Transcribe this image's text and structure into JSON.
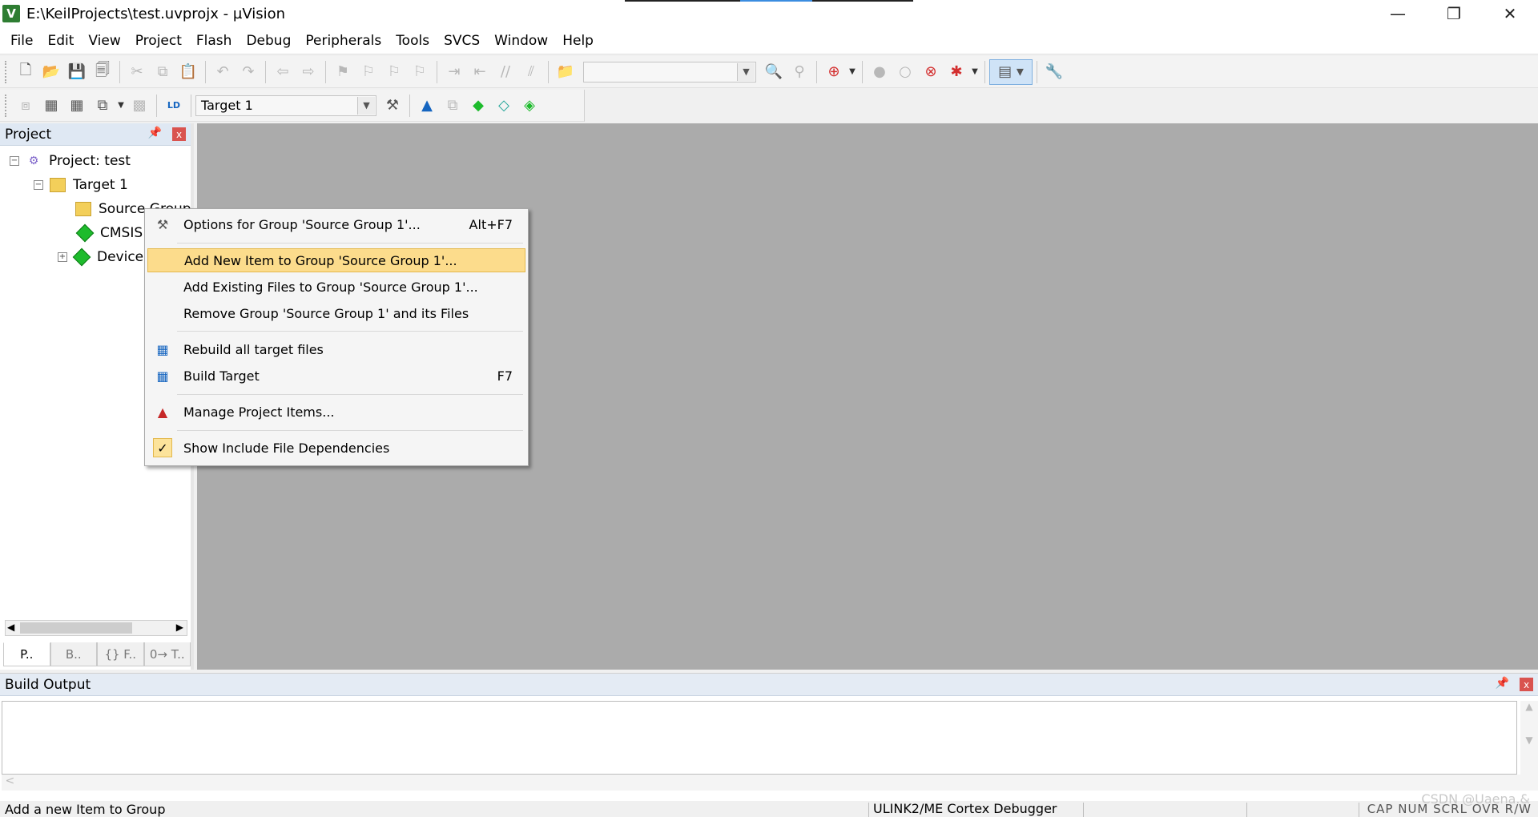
{
  "window": {
    "title": "E:\\KeilProjects\\test.uvprojx - µVision",
    "app_icon_letter": "V",
    "controls": {
      "minimize": "—",
      "restore": "❐",
      "close": "✕"
    }
  },
  "menubar": [
    "File",
    "Edit",
    "View",
    "Project",
    "Flash",
    "Debug",
    "Peripherals",
    "Tools",
    "SVCS",
    "Window",
    "Help"
  ],
  "toolbar2": {
    "target_value": "Target 1"
  },
  "project_panel": {
    "title": "Project",
    "pin": "📌",
    "close": "x",
    "tree": {
      "root": "Project: test",
      "target": "Target 1",
      "group": "Source Group",
      "cmsis": "CMSIS",
      "device": "Device"
    },
    "tabs": [
      {
        "icon": "project-tab-icon",
        "label": "P.."
      },
      {
        "icon": "books-tab-icon",
        "label": "B.."
      },
      {
        "icon": "functions-tab-icon",
        "label": "{} F.."
      },
      {
        "icon": "templates-tab-icon",
        "label": "0→ T.."
      }
    ]
  },
  "context_menu": {
    "items": [
      {
        "icon": "options-icon",
        "label": "Options for Group 'Source Group 1'...",
        "shortcut": "Alt+F7"
      },
      {
        "icon": "",
        "label": "Add New  Item to Group 'Source Group 1'...",
        "shortcut": "",
        "highlighted": true
      },
      {
        "icon": "",
        "label": "Add Existing Files to Group 'Source Group 1'...",
        "shortcut": ""
      },
      {
        "icon": "",
        "label": "Remove Group 'Source Group 1' and its Files",
        "shortcut": ""
      },
      {
        "icon": "rebuild-icon",
        "label": "Rebuild all target files",
        "shortcut": ""
      },
      {
        "icon": "build-icon",
        "label": "Build Target",
        "shortcut": "F7"
      },
      {
        "icon": "manage-items-icon",
        "label": "Manage Project Items...",
        "shortcut": ""
      },
      {
        "icon": "check-icon",
        "label": "Show Include File Dependencies",
        "shortcut": "",
        "checked": true
      }
    ]
  },
  "build_output": {
    "title": "Build Output"
  },
  "statusbar": {
    "message": "Add a new Item to Group",
    "debugger": "ULINK2/ME Cortex Debugger",
    "flags": "CAP  NUM  SCRL  OVR  R/W"
  },
  "watermark": "CSDN @Uaena.&",
  "colors": {
    "workspace": "#ababab",
    "highlight": "#fcdc8c",
    "panel_header": "#dfe8f3",
    "green_component": "#1dbb2c"
  }
}
